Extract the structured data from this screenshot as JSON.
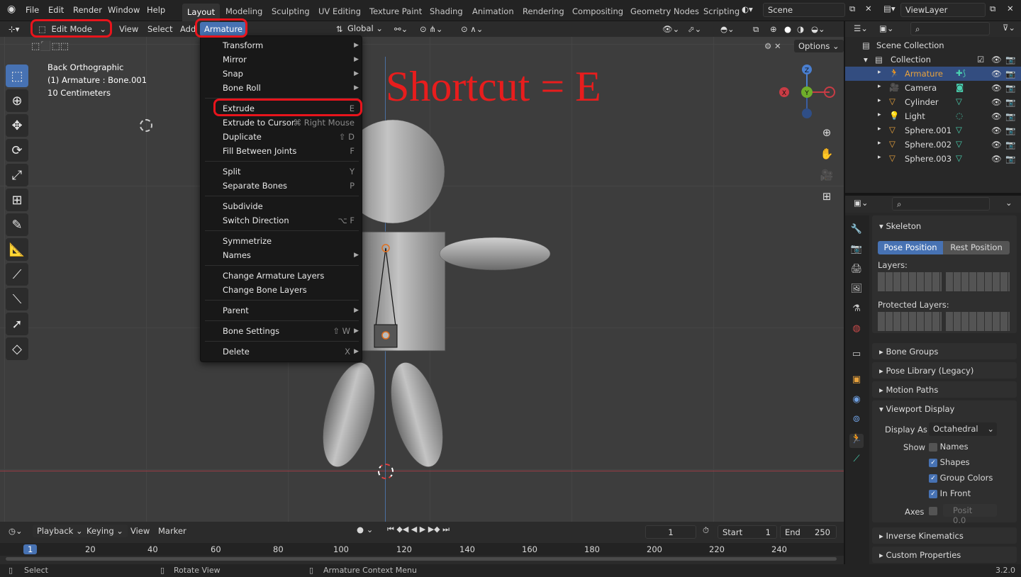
{
  "topbar": {
    "menus": [
      "File",
      "Edit",
      "Render",
      "Window",
      "Help"
    ],
    "workspaces": [
      "Layout",
      "Modeling",
      "Sculpting",
      "UV Editing",
      "Texture Paint",
      "Shading",
      "Animation",
      "Rendering",
      "Compositing",
      "Geometry Nodes",
      "Scripting"
    ],
    "active_workspace": "Layout",
    "scene": "Scene",
    "view_layer": "ViewLayer"
  },
  "header": {
    "mode": "Edit Mode",
    "items": [
      "View",
      "Select",
      "Add",
      "Armature"
    ],
    "transform_orientation": "Global"
  },
  "header2": {
    "options_label": "Options"
  },
  "viewport": {
    "info": [
      "Back Orthographic",
      "(1) Armature : Bone.001",
      "10 Centimeters"
    ],
    "annotation": "Shortcut = E",
    "gizmo": {
      "z": "Z",
      "y": "Y",
      "x": "X"
    }
  },
  "menu": {
    "items": [
      {
        "label": "Transform",
        "shortcut": "",
        "submenu": true
      },
      {
        "label": "Mirror",
        "shortcut": "",
        "submenu": true
      },
      {
        "label": "Snap",
        "shortcut": "",
        "submenu": true
      },
      {
        "label": "Bone Roll",
        "shortcut": "",
        "submenu": true
      },
      {
        "label": "Extrude",
        "shortcut": "E",
        "submenu": false
      },
      {
        "label": "Extrude to Cursor",
        "shortcut": "⌘ Right Mouse",
        "submenu": false
      },
      {
        "label": "Duplicate",
        "shortcut": "⇧ D",
        "submenu": false
      },
      {
        "label": "Fill Between Joints",
        "shortcut": "F",
        "submenu": false
      },
      {
        "label": "Split",
        "shortcut": "Y",
        "submenu": false
      },
      {
        "label": "Separate Bones",
        "shortcut": "P",
        "submenu": false
      },
      {
        "label": "Subdivide",
        "shortcut": "",
        "submenu": false
      },
      {
        "label": "Switch Direction",
        "shortcut": "⌥ F",
        "submenu": false
      },
      {
        "label": "Symmetrize",
        "shortcut": "",
        "submenu": false
      },
      {
        "label": "Names",
        "shortcut": "",
        "submenu": true
      },
      {
        "label": "Change Armature Layers",
        "shortcut": "",
        "submenu": false
      },
      {
        "label": "Change Bone Layers",
        "shortcut": "",
        "submenu": false
      },
      {
        "label": "Parent",
        "shortcut": "",
        "submenu": true
      },
      {
        "label": "Bone Settings",
        "shortcut": "⇧ W",
        "submenu": true
      },
      {
        "label": "Delete",
        "shortcut": "X",
        "submenu": true
      }
    ]
  },
  "timeline": {
    "menus": [
      "Playback",
      "Keying",
      "View",
      "Marker"
    ],
    "current_frame": "1",
    "start_label": "Start",
    "start": "1",
    "end_label": "End",
    "end": "250",
    "ruler": [
      "1",
      "20",
      "40",
      "60",
      "80",
      "100",
      "120",
      "140",
      "160",
      "180",
      "200",
      "220",
      "240"
    ]
  },
  "statusbar": {
    "left": "Select",
    "middle": "Rotate View",
    "right": "Armature Context Menu",
    "version": "3.2.0"
  },
  "outliner": {
    "scene_collection": "Scene Collection",
    "collection": "Collection",
    "objects": [
      {
        "name": "Armature",
        "selected": true,
        "color": "#e8a23c"
      },
      {
        "name": "Camera",
        "selected": false,
        "color": "#e8a23c"
      },
      {
        "name": "Cylinder",
        "selected": false,
        "color": "#e8a23c"
      },
      {
        "name": "Light",
        "selected": false,
        "color": "#e8a23c"
      },
      {
        "name": "Sphere.001",
        "selected": false,
        "color": "#e8a23c"
      },
      {
        "name": "Sphere.002",
        "selected": false,
        "color": "#e8a23c"
      },
      {
        "name": "Sphere.003",
        "selected": false,
        "color": "#e8a23c"
      }
    ]
  },
  "properties": {
    "skeleton_title": "Skeleton",
    "pose_position": "Pose Position",
    "rest_position": "Rest Position",
    "layers_label": "Layers:",
    "protected_layers_label": "Protected Layers:",
    "bone_groups": "Bone Groups",
    "pose_library": "Pose Library (Legacy)",
    "motion_paths": "Motion Paths",
    "viewport_display": "Viewport Display",
    "display_as_label": "Display As",
    "display_as": "Octahedral",
    "show_label": "Show",
    "names": "Names",
    "shapes": "Shapes",
    "group_colors": "Group Colors",
    "in_front": "In Front",
    "axes_label": "Axes",
    "axes_position": "Posit",
    "axes_value": "0.0",
    "inverse_kinematics": "Inverse Kinematics",
    "custom_properties": "Custom Properties"
  }
}
